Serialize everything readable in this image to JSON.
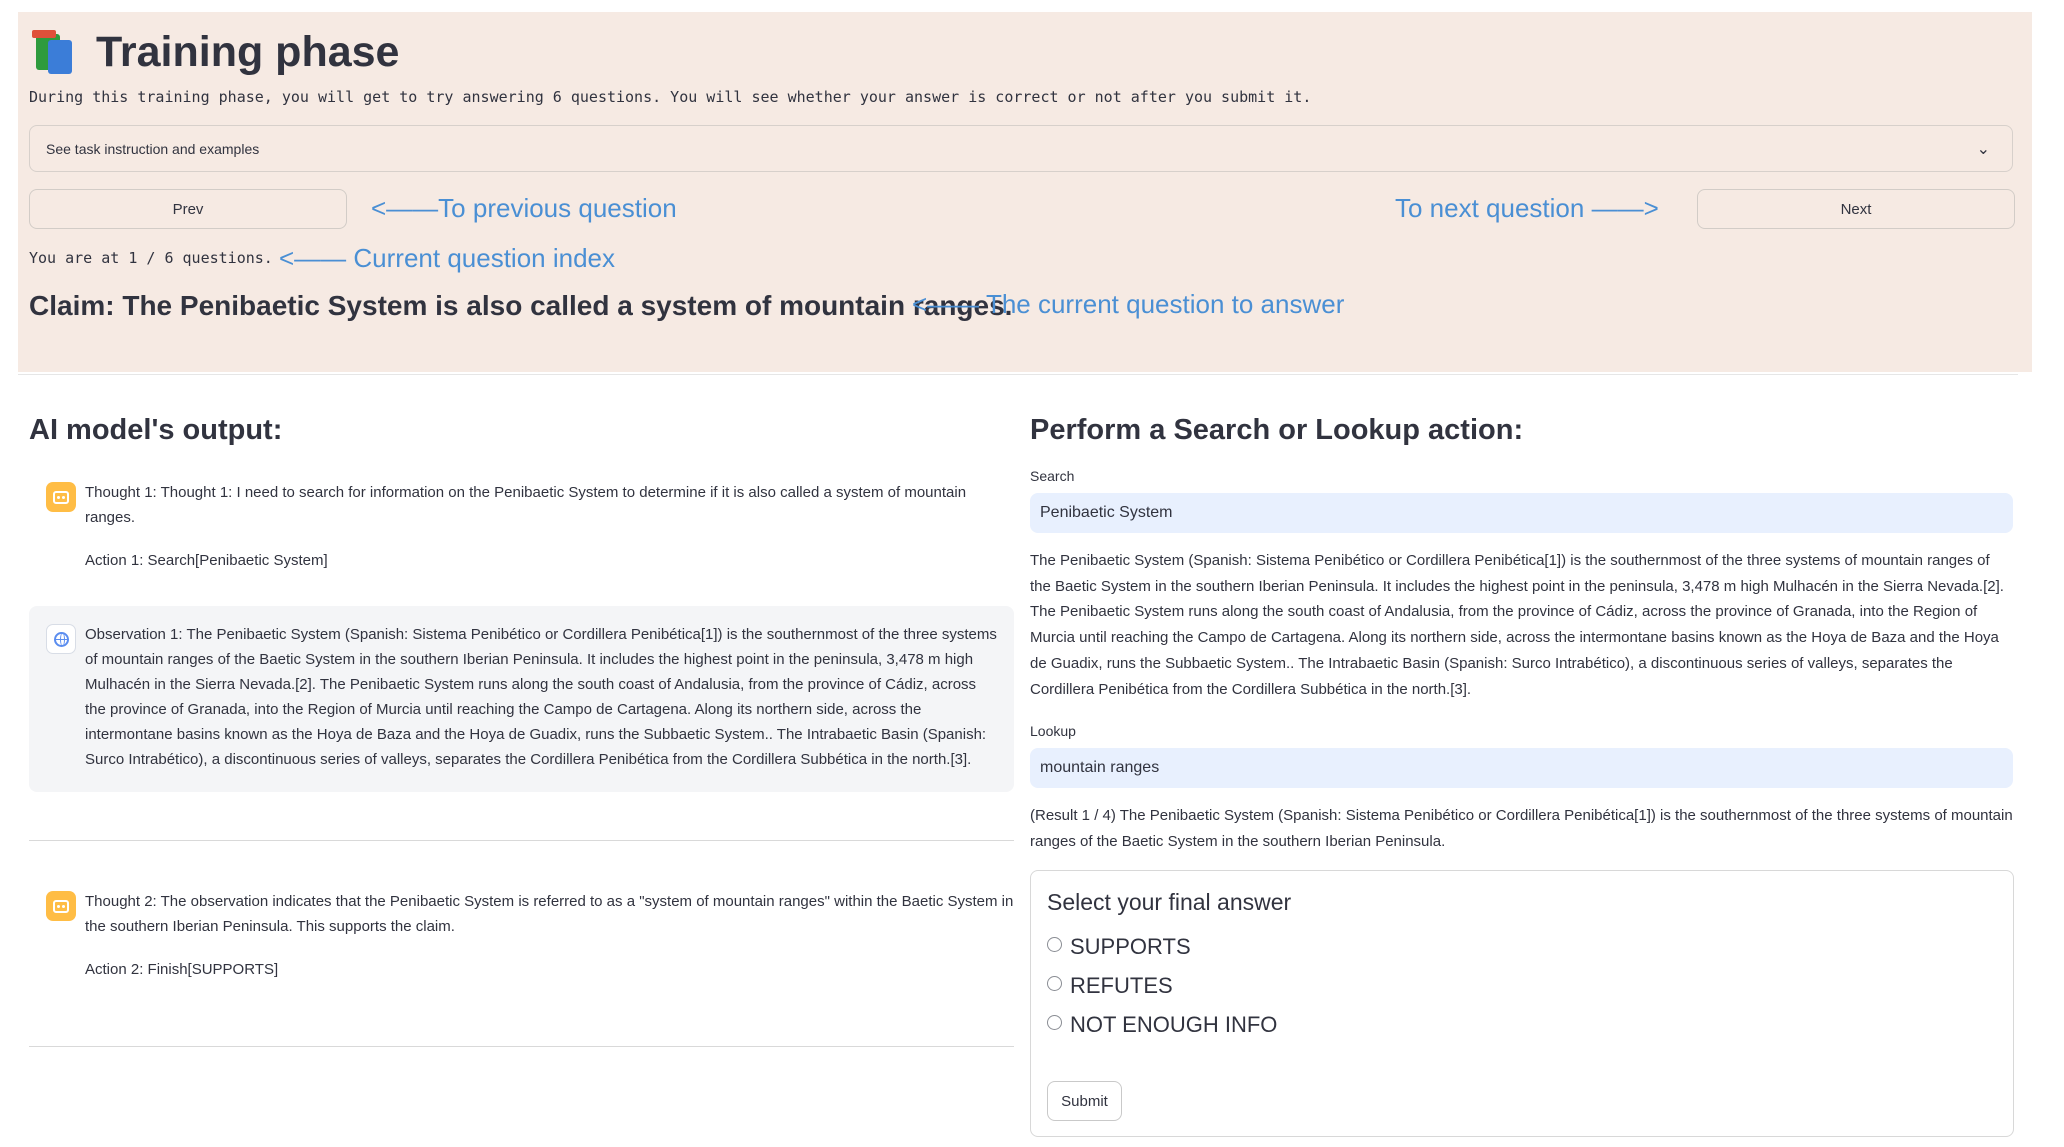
{
  "header": {
    "title": "Training phase",
    "intro": "During this training phase, you will get to try answering 6 questions. You will see whether your answer is correct or not after you submit it.",
    "expander_label": "See task instruction and examples",
    "prev_label": "Prev",
    "next_label": "Next",
    "question_index": "You are at 1 / 6 questions.",
    "claim": "Claim: The Penibaetic System is also called a system of mountain ranges."
  },
  "annotations": {
    "prev": "<——To previous question",
    "next": "To next question ——>",
    "index": "<—— Current question index",
    "claim": "<—— The current question to answer"
  },
  "ai_output": {
    "heading": "AI model's output:",
    "thought1": "Thought 1: Thought 1: I need to search for information on the Penibaetic System to determine if it is also called a system of mountain ranges.",
    "action1": "Action 1: Search[Penibaetic System]",
    "observation1": "Observation 1: The Penibaetic System (Spanish: Sistema Penibético or Cordillera Penibética[1]) is the southernmost of the three systems of mountain ranges of the Baetic System in the southern Iberian Peninsula. It includes the highest point in the peninsula, 3,478 m high Mulhacén in the Sierra Nevada.[2]. The Penibaetic System runs along the south coast of Andalusia, from the province of Cádiz, across the province of Granada, into the Region of Murcia until reaching the Campo de Cartagena. Along its northern side, across the intermontane basins known as the Hoya de Baza and the Hoya de Guadix, runs the Subbaetic System.. The Intrabaetic Basin (Spanish: Surco Intrabético), a discontinuous series of valleys, separates the Cordillera Penibética from the Cordillera Subbética in the north.[3].",
    "thought2": "Thought 2: The observation indicates that the Penibaetic System is referred to as a \"system of mountain ranges\" within the Baetic System in the southern Iberian Peninsula. This supports the claim.",
    "action2": "Action 2: Finish[SUPPORTS]"
  },
  "actions": {
    "heading": "Perform a Search or Lookup action:",
    "search_label": "Search",
    "search_value": "Penibaetic System",
    "search_result": "The Penibaetic System (Spanish: Sistema Penibético or Cordillera Penibética[1]) is the southernmost of the three systems of mountain ranges of the Baetic System in the southern Iberian Peninsula. It includes the highest point in the peninsula, 3,478 m high Mulhacén in the Sierra Nevada.[2]. The Penibaetic System runs along the south coast of Andalusia, from the province of Cádiz, across the province of Granada, into the Region of Murcia until reaching the Campo de Cartagena. Along its northern side, across the intermontane basins known as the Hoya de Baza and the Hoya de Guadix, runs the Subbaetic System.. The Intrabaetic Basin (Spanish: Surco Intrabético), a discontinuous series of valleys, separates the Cordillera Penibética from the Cordillera Subbética in the north.[3].",
    "lookup_label": "Lookup",
    "lookup_value": "mountain ranges",
    "lookup_result": "(Result 1 / 4) The Penibaetic System (Spanish: Sistema Penibético or Cordillera Penibética[1]) is the southernmost of the three systems of mountain ranges of the Baetic System in the southern Iberian Peninsula."
  },
  "final_answer": {
    "label": "Select your final answer",
    "options": [
      "SUPPORTS",
      "REFUTES",
      "NOT ENOUGH INFO"
    ],
    "submit_label": "Submit"
  },
  "colors": {
    "panel_bg": "#f6eae3",
    "annotation": "#4a8fd4",
    "input_bg": "#e8f0fe",
    "bot_avatar": "#ffbd45"
  }
}
